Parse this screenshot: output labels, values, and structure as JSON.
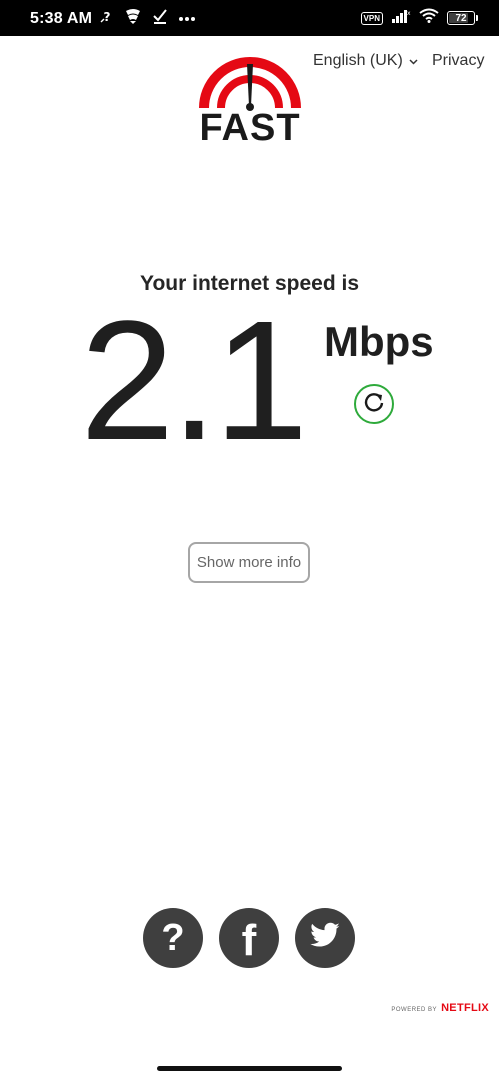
{
  "status_bar": {
    "time": "5:38 AM",
    "vpn_label": "VPN",
    "battery_level": "72",
    "battery_fraction": 0.72,
    "left_icons": [
      "question-icon",
      "shield-signal-icon",
      "check-icon",
      "more-dots-icon"
    ],
    "right_icons": [
      "vpn-icon",
      "cellular-signal-icon",
      "wifi-icon",
      "battery-icon"
    ]
  },
  "header": {
    "language_label": "English (UK)",
    "privacy_label": "Privacy",
    "logo_text": "FAST"
  },
  "speed": {
    "caption": "Your internet speed is",
    "value": "2.1",
    "unit": "Mbps"
  },
  "more_info_label": "Show more info",
  "social": [
    "help-icon",
    "facebook-icon",
    "twitter-icon"
  ],
  "footer": {
    "powered_by": "POWERED BY",
    "brand": "NETFLIX"
  },
  "colors": {
    "accent_green": "#2eaa3b",
    "logo_red": "#e50914",
    "netflix_red": "#e50914",
    "social_bg": "#3f3f3f"
  }
}
